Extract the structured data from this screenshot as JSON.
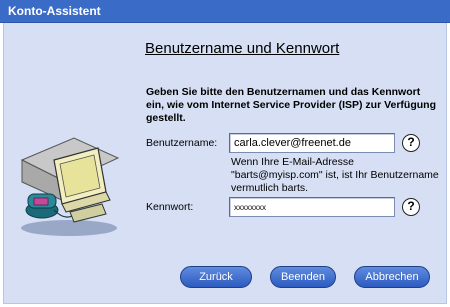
{
  "window": {
    "title": "Konto-Assistent"
  },
  "page": {
    "heading": "Benutzername und Kennwort",
    "intro": "Geben Sie bitte den Benutzernamen und das Kennwort ein, wie vom Internet Service Provider (ISP) zur Verfügung gestellt."
  },
  "form": {
    "username_label": "Benutzername:",
    "username_value": "carla.clever@freenet.de",
    "hint": "Wenn Ihre E-Mail-Adresse \"barts@myisp.com\" ist, ist Ihr Benutzername vermutlich barts.",
    "password_label": "Kennwort:",
    "password_value": "xxxxxxxx",
    "help_glyph": "?"
  },
  "buttons": {
    "back": "Zurück",
    "finish": "Beenden",
    "cancel": "Abbrechen"
  },
  "icons": {
    "illustration": "computer-with-phone-illustration-icon",
    "help": "question-mark-icon"
  },
  "colors": {
    "titlebar": "#3a6bc6",
    "client_background": "#d6dff3",
    "button": "#3a6bc6"
  }
}
